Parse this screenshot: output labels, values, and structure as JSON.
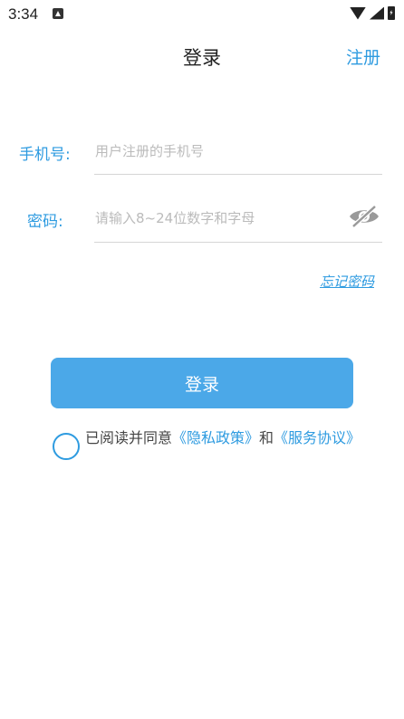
{
  "status_bar": {
    "time": "3:34",
    "notification_icon": "a-icon",
    "wifi_icon": "wifi-icon",
    "signal_icon": "signal-icon",
    "battery_icon": "battery-charging-icon"
  },
  "header": {
    "title": "登录",
    "register_label": "注册"
  },
  "phone": {
    "label": "手机号:",
    "placeholder": "用户注册的手机号",
    "value": ""
  },
  "password": {
    "label": "密码:",
    "placeholder": "请输入8~24位数字和字母",
    "value": "",
    "toggle_icon": "eye-off-icon"
  },
  "forgot_label": "忘记密码",
  "login_button_label": "登录",
  "agreement": {
    "checked": false,
    "prefix": "已阅读并同意",
    "privacy_link": "《隐私政策》",
    "and": "和",
    "service_link": "《服务协议》"
  },
  "colors": {
    "accent": "#2e9be0",
    "button": "#4ba8e8",
    "placeholder": "#bbbbbb",
    "divider": "#d5d5d5"
  }
}
